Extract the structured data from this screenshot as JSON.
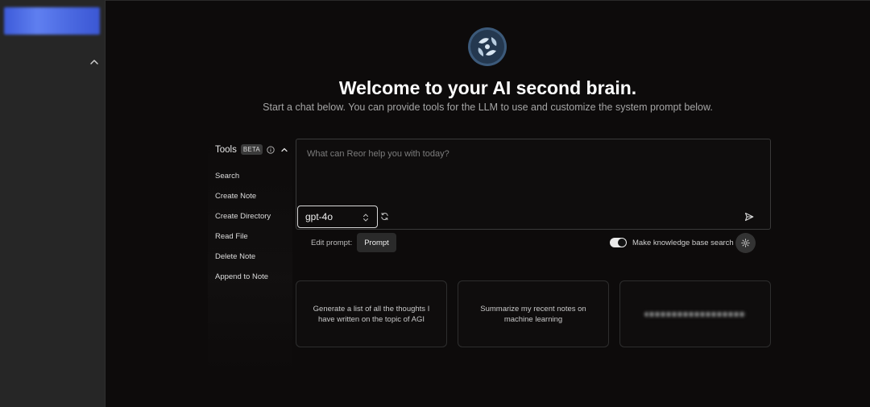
{
  "header": {
    "title": "Welcome to your AI second brain.",
    "subtitle": "Start a chat below. You can provide tools for the LLM to use and customize the system prompt below."
  },
  "tools": {
    "title": "Tools",
    "badge": "BETA",
    "items": [
      {
        "label": "Search"
      },
      {
        "label": "Create Note"
      },
      {
        "label": "Create Directory"
      },
      {
        "label": "Read File"
      },
      {
        "label": "Delete Note"
      },
      {
        "label": "Append to Note"
      }
    ]
  },
  "chat": {
    "placeholder": "What can Reor help you with today?",
    "model": "gpt-4o"
  },
  "prompt": {
    "edit_label": "Edit prompt:",
    "button_label": "Prompt"
  },
  "knowledge_base": {
    "label": "Make knowledge base search",
    "enabled": true
  },
  "suggestions": [
    {
      "text": "Generate a list of all the thoughts I have written on the topic of AGI"
    },
    {
      "text": "Summarize my recent notes on machine learning"
    },
    {
      "text": ""
    }
  ],
  "icons": {
    "sidebar_toggle": "chevron-up-icon",
    "logo": "brain-logo-icon",
    "info": "info-icon",
    "collapse": "chevron-up-icon",
    "select": "select-arrows-icon",
    "refresh": "refresh-icon",
    "send": "send-icon",
    "settings": "gear-icon"
  },
  "colors": {
    "background": "#0d0b0b",
    "sidebar": "#262626",
    "sidebar_header": "#4a68e0",
    "logo_ring": "#3c5a7a"
  }
}
